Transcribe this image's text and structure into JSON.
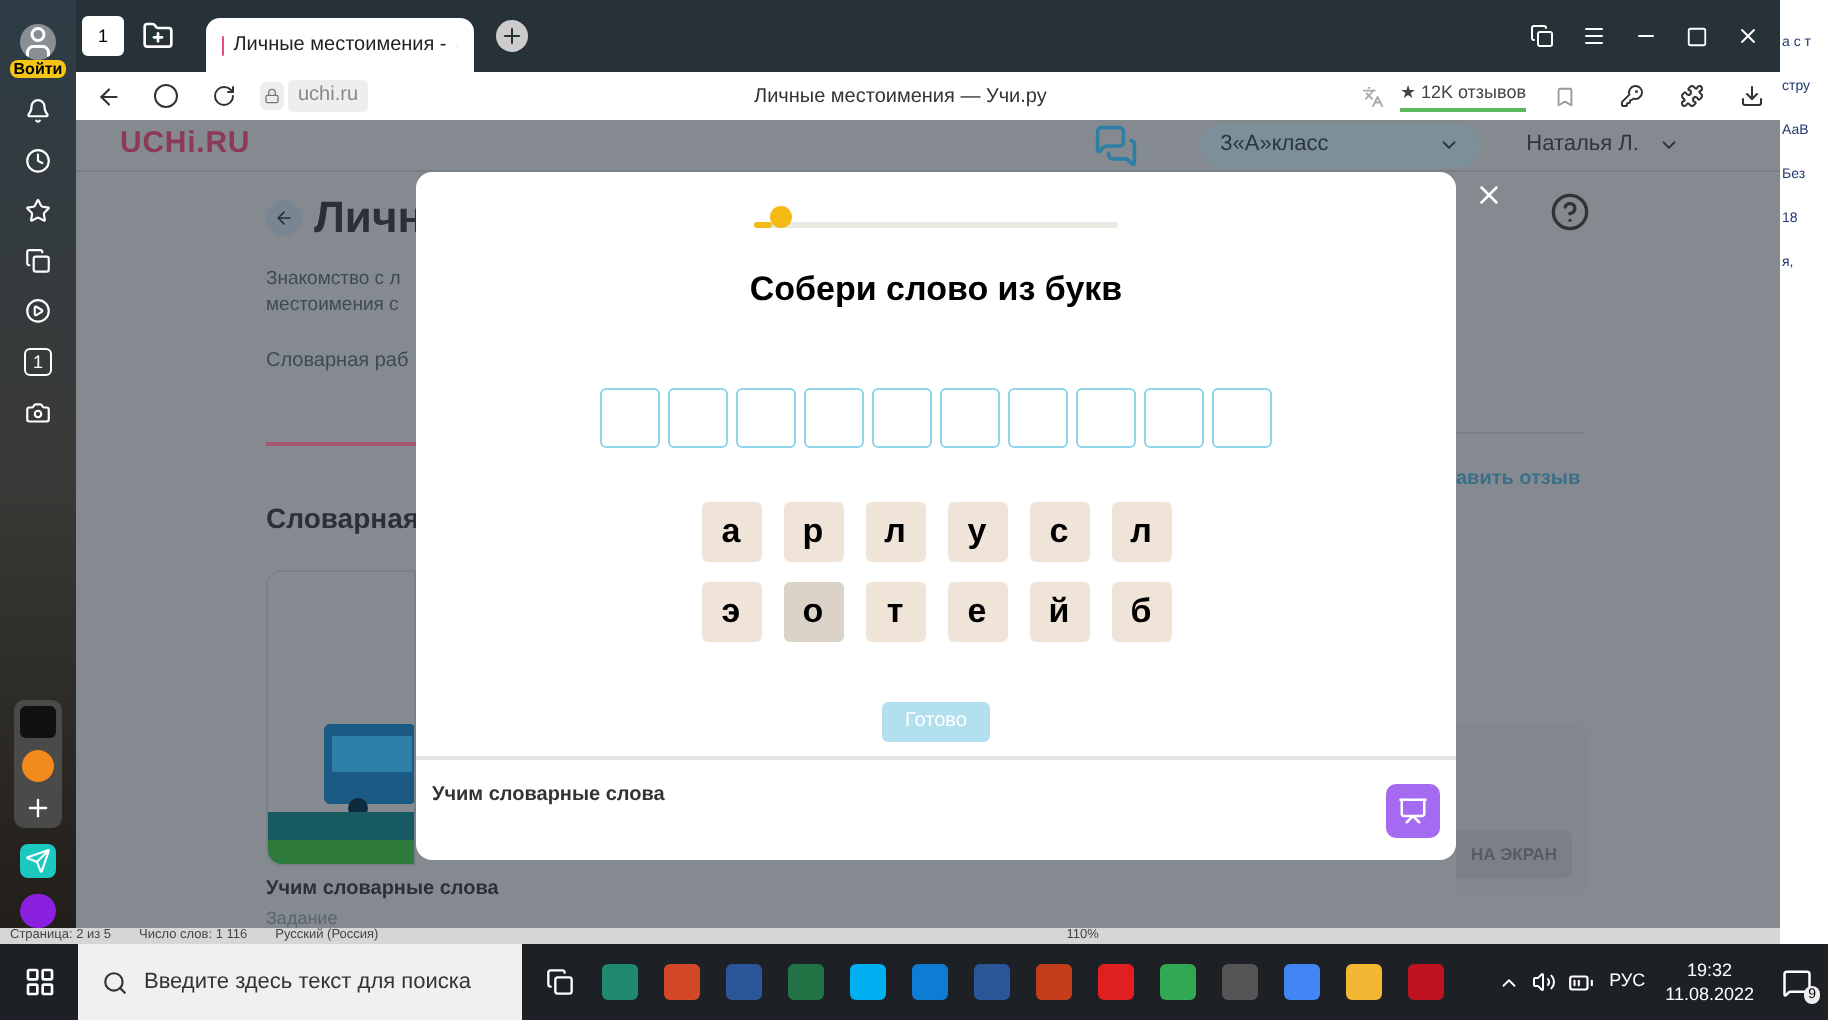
{
  "browser": {
    "login_badge": "Войти",
    "home_counter": "1",
    "tabs": [
      {
        "title": "Личные местоимения -",
        "selected": true
      }
    ],
    "url": "uchi.ru",
    "page_title": "Личные местоимения — Учи.ру",
    "reviews": "★ 12K отзывов",
    "sidebar_counter": "1"
  },
  "page": {
    "logo": "UCHi.RU",
    "class_select": "3«А»класс",
    "user": "Наталья Л.",
    "title": "Личн",
    "description": [
      "Знакомство с л",
      "местоимения с"
    ],
    "tab": "Словарная раб",
    "section_title": "Словарная",
    "feedback_link": "авить отзыв",
    "card_title": "Учим словарные слова",
    "card_meta": "Задание",
    "screen_button": "НА ЭКРАН"
  },
  "modal": {
    "progress": {
      "level": 0.05
    },
    "title": "Собери слово из букв",
    "slots": [
      {
        "filled": false
      },
      {
        "filled": false
      },
      {
        "filled": false
      },
      {
        "filled": false
      },
      {
        "filled": false
      },
      {
        "filled": false
      },
      {
        "filled": false
      },
      {
        "filled": false
      },
      {
        "filled": false
      },
      {
        "filled": false
      }
    ],
    "letters": [
      {
        "char": "а",
        "selected": false
      },
      {
        "char": "р",
        "selected": false
      },
      {
        "char": "л",
        "selected": false
      },
      {
        "char": "у",
        "selected": false
      },
      {
        "char": "с",
        "selected": false
      },
      {
        "char": "л",
        "selected": false
      },
      {
        "char": "э",
        "selected": false
      },
      {
        "char": "о",
        "selected": true
      },
      {
        "char": "т",
        "selected": false
      },
      {
        "char": "е",
        "selected": false
      },
      {
        "char": "й",
        "selected": false
      },
      {
        "char": "б",
        "selected": false
      }
    ],
    "done_button": {
      "label": "Готово",
      "disabled": true
    },
    "footer_title": "Учим словарные слова"
  },
  "word_window": {
    "ribbon_texts": [
      "а с т",
      "стру",
      "АаВ",
      "Без",
      "18",
      "я,"
    ],
    "status": [
      "Страница: 2 из 5",
      "Число слов: 1 116",
      "Русский (Россия)",
      "110%"
    ]
  },
  "taskbar": {
    "search_placeholder": "Введите здесь текст для поиска",
    "language": "РУС",
    "time": "19:32",
    "date": "11.08.2022",
    "notifications": "9"
  }
}
